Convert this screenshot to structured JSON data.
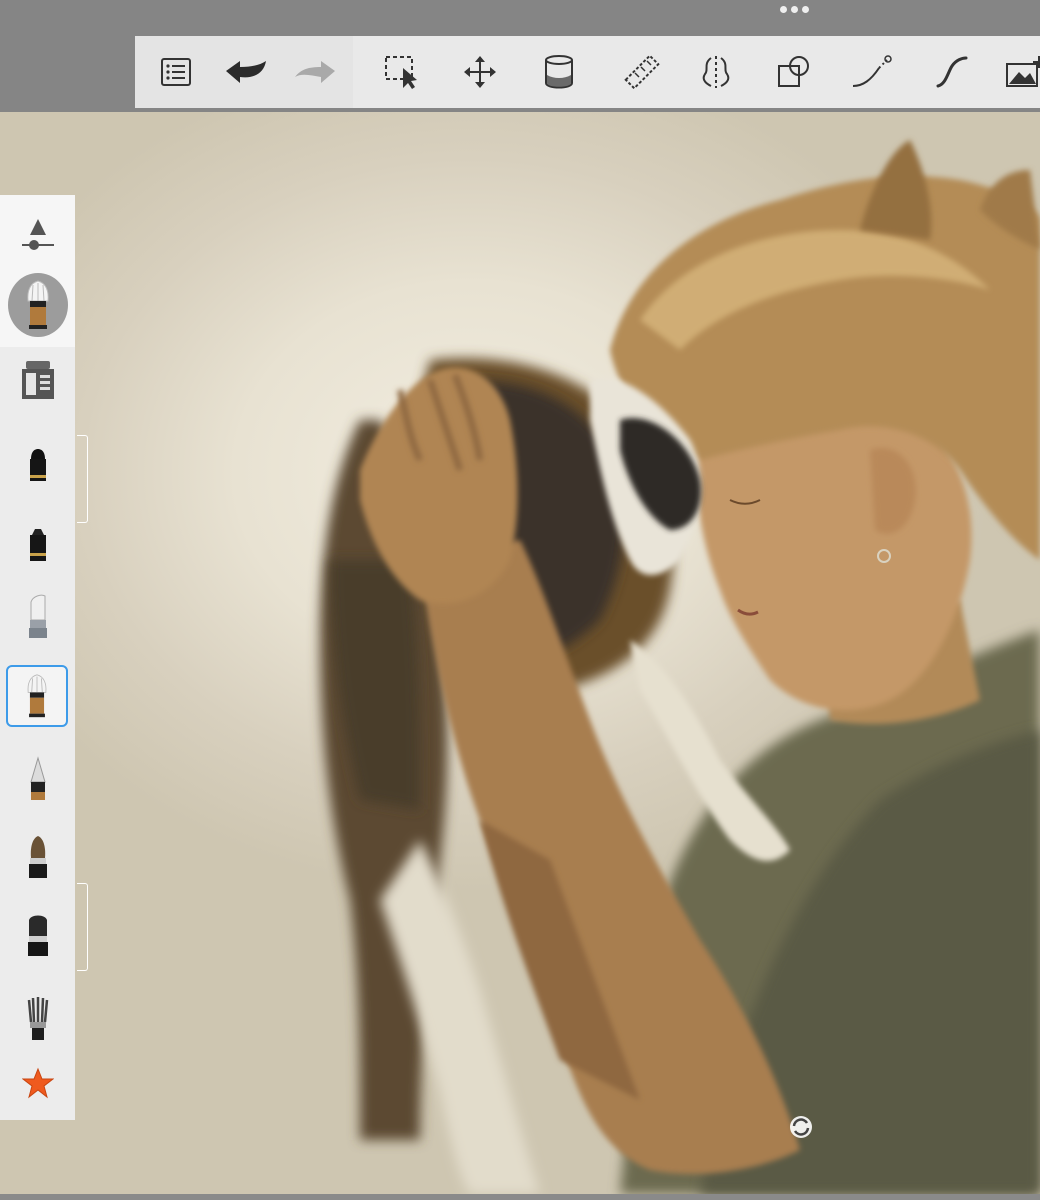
{
  "toolbar": {
    "buttons": [
      {
        "name": "layers-list-icon"
      },
      {
        "name": "undo-icon"
      },
      {
        "name": "redo-icon"
      },
      {
        "name": "selection-icon"
      },
      {
        "name": "transform-move-icon"
      },
      {
        "name": "fill-bucket-icon"
      },
      {
        "name": "ruler-guide-icon"
      },
      {
        "name": "symmetry-icon"
      },
      {
        "name": "shapes-icon"
      },
      {
        "name": "stroke-path-icon"
      },
      {
        "name": "curve-stroke-icon"
      },
      {
        "name": "add-image-icon"
      }
    ]
  },
  "sidebar": {
    "brushes": [
      {
        "name": "brush-properties-icon"
      },
      {
        "name": "bristle-brush-active-icon"
      },
      {
        "name": "brush-library-icon"
      },
      {
        "name": "ballpoint-pen-icon"
      },
      {
        "name": "marker-icon"
      },
      {
        "name": "chisel-brush-icon"
      },
      {
        "name": "bristle-brush-selected-icon"
      },
      {
        "name": "pencil-icon"
      },
      {
        "name": "paint-brush-icon"
      },
      {
        "name": "flat-brush-icon"
      },
      {
        "name": "fan-brush-icon"
      },
      {
        "name": "favorites-star-icon"
      }
    ]
  },
  "colors": {
    "accent": "#3d9be9",
    "toolbar_bg": "#e9e9e9",
    "frame_bg": "#858585",
    "star": "#ef5a1e"
  }
}
